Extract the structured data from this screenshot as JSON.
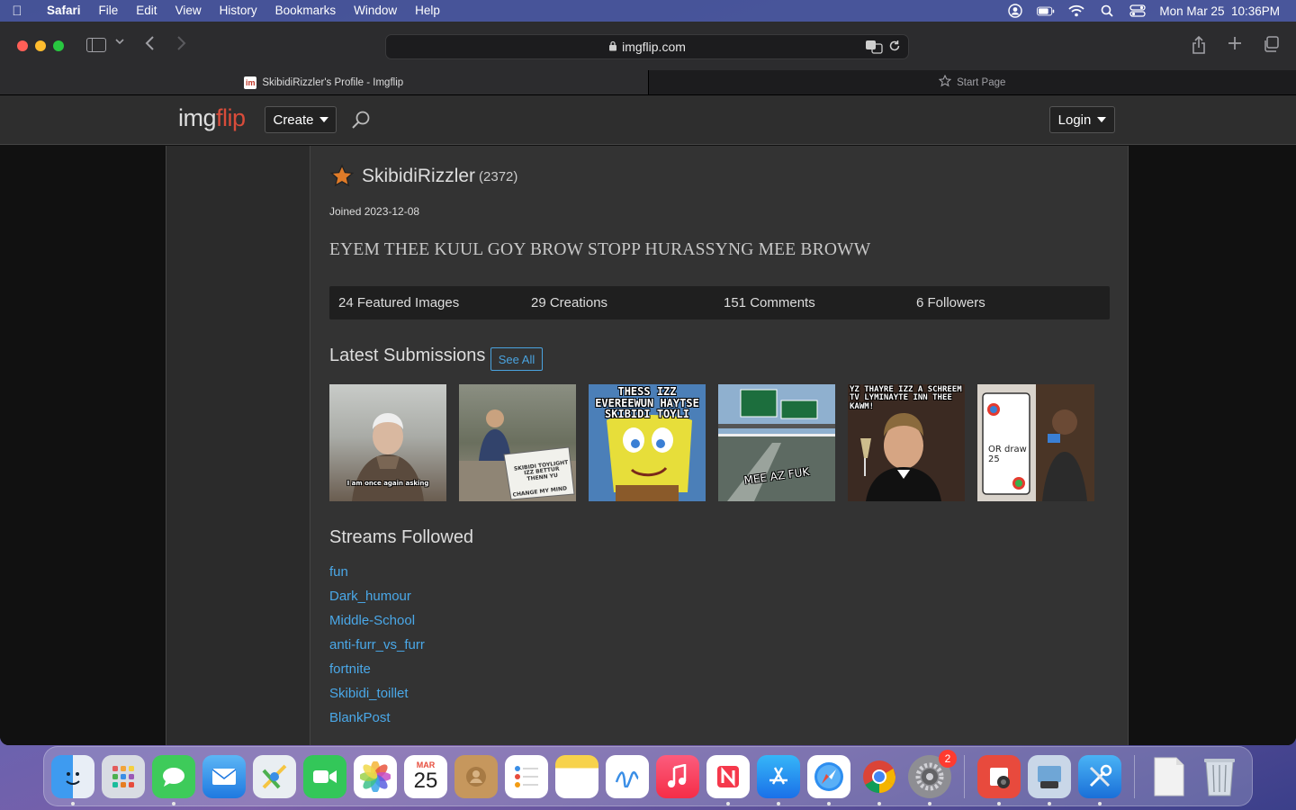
{
  "menubar": {
    "app_name": "Safari",
    "items": [
      "File",
      "Edit",
      "View",
      "History",
      "Bookmarks",
      "Window",
      "Help"
    ],
    "datetime": "Mon Mar 25  10:36PM"
  },
  "browser": {
    "url": "imgflip.com",
    "tabs": [
      {
        "title": "SkibidiRizzler's Profile - Imgflip",
        "active": true
      },
      {
        "title": "Start Page",
        "active": false
      }
    ]
  },
  "site": {
    "logo_img": "img",
    "logo_flip": "flip",
    "create_label": "Create",
    "login_label": "Login"
  },
  "profile": {
    "username": "SkibidiRizzler",
    "points": "(2372)",
    "joined": "Joined 2023-12-08",
    "bio": "EYEM THEE KUUL GOY BROW STOPP HURASSYNG MEE BROWW",
    "stats": [
      "24 Featured Images",
      "29 Creations",
      "151 Comments",
      "6 Followers"
    ]
  },
  "latest": {
    "title": "Latest Submissions",
    "see_all": "See All",
    "thumbs": [
      {
        "caption_top": "",
        "caption_bottom": "I am once again asking"
      },
      {
        "caption_top": "",
        "caption_bottom": "SKIBIDI TOYLIGHT IZZ BETTUR THENN YU"
      },
      {
        "caption_top": "THESS IZZ EVEREEWUN HAYTSE SKIBIDI TOYLI",
        "caption_bottom": ""
      },
      {
        "caption_top": "",
        "caption_bottom": "MEE AZ FUK"
      },
      {
        "caption_top": "YZ THAYRE IZZ A SCHREEM TV LYMINAYTE INN THEE KAWM!",
        "caption_bottom": ""
      },
      {
        "caption_top": "",
        "caption_bottom": "OR draw 25"
      }
    ]
  },
  "streams": {
    "title": "Streams Followed",
    "items": [
      "fun",
      "Dark_humour",
      "Middle-School",
      "anti-furr_vs_furr",
      "fortnite",
      "Skibidi_toillet",
      "BlankPost"
    ]
  },
  "dock": {
    "calendar_month": "MAR",
    "calendar_day": "25",
    "settings_badge": "2"
  }
}
